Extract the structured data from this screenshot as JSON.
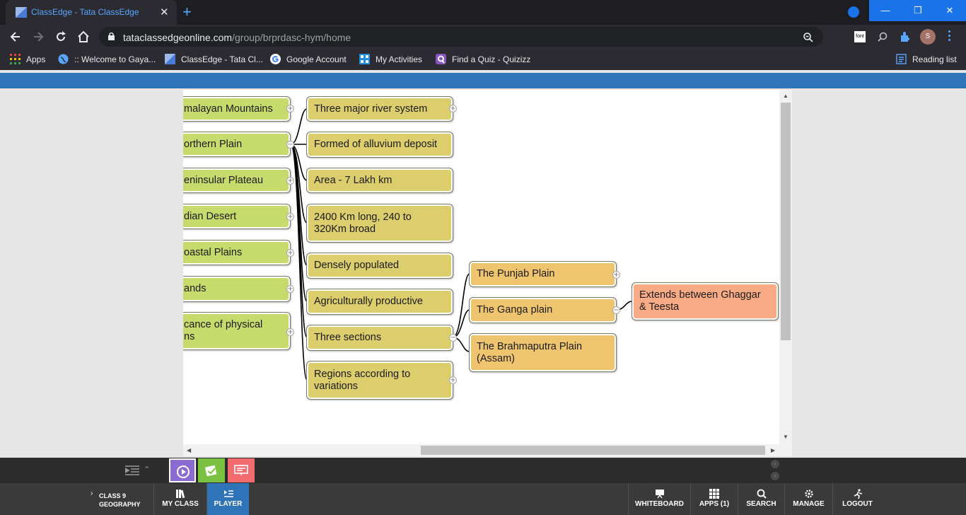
{
  "browser": {
    "tab_title": "ClassEdge - Tata ClassEdge",
    "tab_close": "✕",
    "new_tab": "+",
    "url_host": "tataclassedgeonline.com",
    "url_path": "/group/brprdasc-hym/home",
    "window_controls": {
      "minimize": "—",
      "restore": "❐",
      "close": "✕"
    },
    "profile_initial": "S",
    "extension_label": "font",
    "bookmarks": [
      {
        "label": "Apps",
        "icon": "apps-grid-icon"
      },
      {
        "label": ":: Welcome to Gaya...",
        "icon": "globe-icon"
      },
      {
        "label": "ClassEdge - Tata Cl...",
        "icon": "classedge-icon"
      },
      {
        "label": "Google Account",
        "icon": "google-icon"
      },
      {
        "label": "My Activities",
        "icon": "activities-icon"
      },
      {
        "label": "Find a Quiz - Quizizz",
        "icon": "quizizz-icon"
      }
    ],
    "reading_list": "Reading list"
  },
  "mindmap": {
    "colors": {
      "level1": "#c7db6d",
      "level2": "#dcce6c",
      "level3": "#efc46e",
      "level4": "#f9ab86"
    },
    "level1": [
      {
        "label": "malayan Mountains",
        "toggle": "+"
      },
      {
        "label": "orthern Plain",
        "toggle": "−"
      },
      {
        "label": "eninsular Plateau",
        "toggle": "+"
      },
      {
        "label": "dian Desert",
        "toggle": "+"
      },
      {
        "label": "oastal Plains",
        "toggle": "+"
      },
      {
        "label": "ands",
        "toggle": "+"
      },
      {
        "label": "cance of physical\nns",
        "toggle": "+"
      }
    ],
    "level2": [
      {
        "label": "Three major river system",
        "toggle": "+"
      },
      {
        "label": "Formed of alluvium deposit"
      },
      {
        "label": "Area - 7 Lakh km"
      },
      {
        "label": "2400 Km long, 240 to\n320Km broad"
      },
      {
        "label": "Densely populated"
      },
      {
        "label": "Agriculturally productive"
      },
      {
        "label": "Three sections",
        "toggle": "−"
      },
      {
        "label": "Regions according to\nvariations",
        "toggle": "+"
      }
    ],
    "level3": [
      {
        "label": "The Punjab Plain",
        "toggle": "+"
      },
      {
        "label": "The Ganga plain",
        "toggle": "−"
      },
      {
        "label": "The Brahmaputra Plain\n(Assam)"
      }
    ],
    "level4": [
      {
        "label": "Extends between Ghaggar\n& Teesta"
      }
    ]
  },
  "dock": {
    "buttons": [
      {
        "name": "player-dock-button",
        "color": "#8c6bd1"
      },
      {
        "name": "notes-dock-button",
        "color": "#7cc242"
      },
      {
        "name": "presentation-dock-button",
        "color": "#f16b6f"
      }
    ]
  },
  "navbar": {
    "class_line1": "CLASS 9",
    "class_line2": "GEOGRAPHY",
    "my_class": "MY CLASS",
    "player": "PLAYER",
    "whiteboard": "WHITEBOARD",
    "apps": "APPS (1)",
    "search": "SEARCH",
    "manage": "MANAGE",
    "logout": "LOGOUT"
  }
}
